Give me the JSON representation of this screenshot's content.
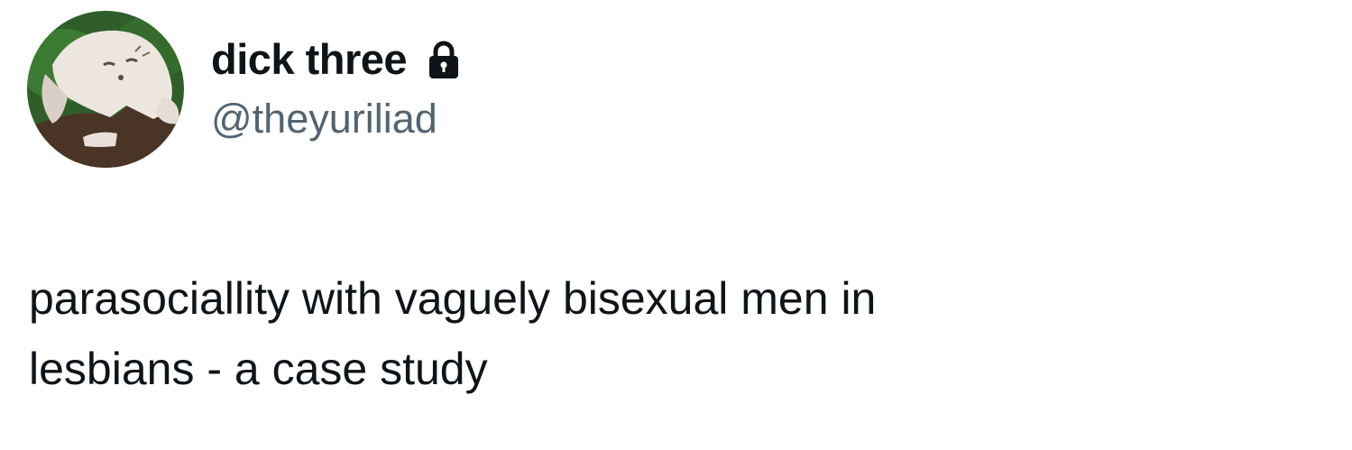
{
  "author": {
    "display_name": "dick three",
    "handle": "@theyuriliad",
    "protected_icon": "lock-icon",
    "avatar_icon": "avatar-image"
  },
  "tweet": {
    "text": "parasociallity with vaguely bisexual men in\nlesbians - a case study"
  },
  "colors": {
    "text_primary": "#0f1419",
    "text_secondary": "#536471",
    "background": "#ffffff"
  }
}
